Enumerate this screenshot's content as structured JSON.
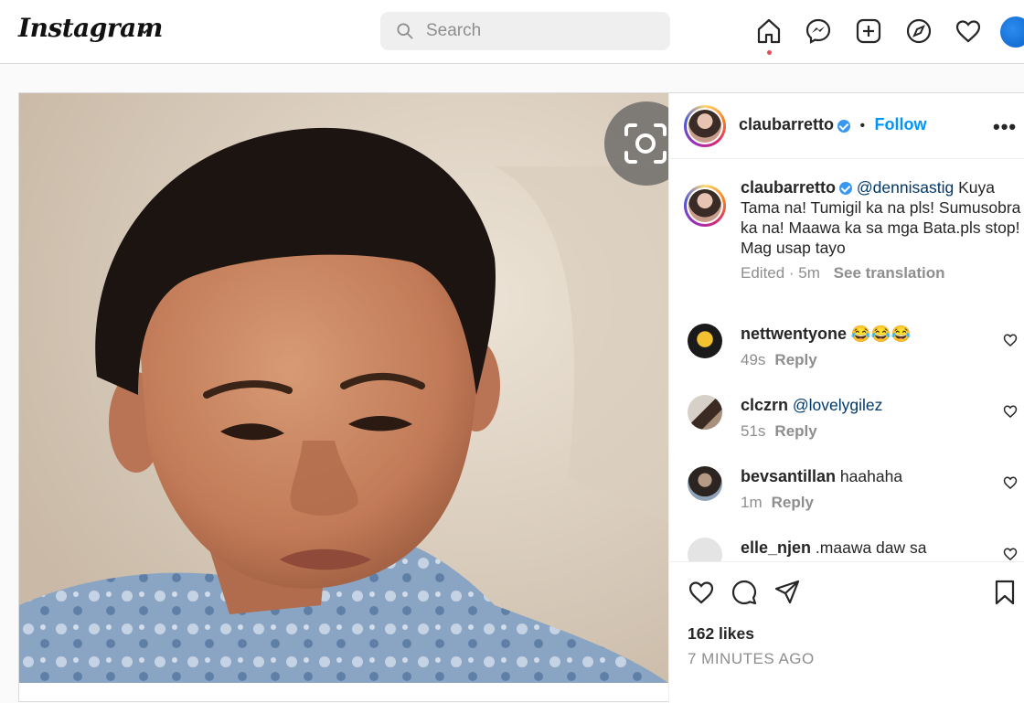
{
  "app": {
    "logo_text": "Instagram"
  },
  "search": {
    "placeholder": "Search",
    "value": ""
  },
  "nav": {
    "icons": [
      "home-icon",
      "messenger-icon",
      "new-post-icon",
      "explore-icon",
      "activity-heart-icon",
      "profile-avatar"
    ]
  },
  "post": {
    "author": "claubarretto",
    "verified": true,
    "separator": "•",
    "follow_label": "Follow",
    "more_label": "•••",
    "caption": {
      "author": "claubarretto",
      "mention": "@dennisastig",
      "text": "Kuya Tama na! Tumigil ka na pls! Sumusobra ka na! Maawa ka sa mga Bata.pls stop! Mag usap tayo",
      "meta": "Edited · 5m",
      "translate_label": "See translation"
    },
    "comments": [
      {
        "user": "nettwentyone",
        "mention": "",
        "text": "😂😂😂",
        "time": "49s",
        "reply": "Reply"
      },
      {
        "user": "clczrn",
        "mention": "@lovelygilez",
        "text": "",
        "time": "51s",
        "reply": "Reply"
      },
      {
        "user": "bevsantillan",
        "mention": "",
        "text": "haahaha",
        "time": "1m",
        "reply": "Reply"
      },
      {
        "user": "elle_njen",
        "mention": "",
        "text": ".maawa daw sa",
        "time": "",
        "reply": ""
      }
    ],
    "likes": "162 likes",
    "posted": "7 MINUTES AGO"
  },
  "colors": {
    "link": "#0095f6",
    "mention": "#00376b",
    "notification": "#ed4956",
    "verified": "#3897f0"
  }
}
